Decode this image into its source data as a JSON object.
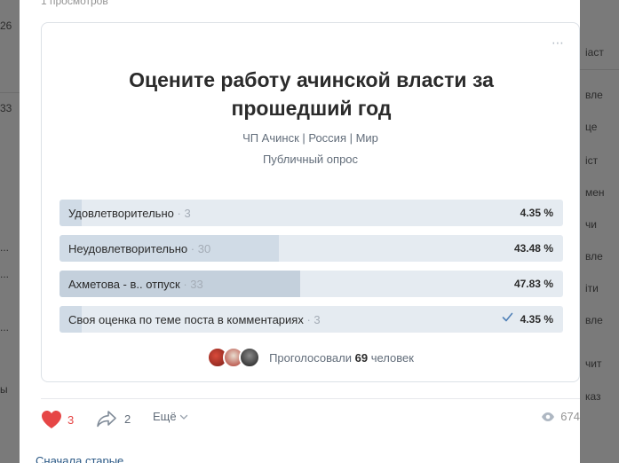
{
  "background": {
    "left_fragments": [
      "26",
      "33",
      "...",
      "...",
      "...",
      "ы"
    ],
    "right_fragments": [
      "іаст",
      "вле",
      "це",
      "іст",
      "мен",
      "чи",
      "вле",
      "іти",
      "вле",
      "чит",
      "каз"
    ]
  },
  "post": {
    "views_top": "1 просмотров",
    "poll": {
      "menu_icon": "⋯",
      "title": "Оцените работу ачинской власти за прошедший год",
      "source": "ЧП Ачинск | Россия | Мир",
      "type": "Публичный опрос",
      "options": [
        {
          "label": "Удовлетворительно",
          "count": "· 3",
          "percent": "4.35 %",
          "fraction": 0.0435,
          "voted": false
        },
        {
          "label": "Неудовлетворительно",
          "count": "· 30",
          "percent": "43.48 %",
          "fraction": 0.4348,
          "voted": false
        },
        {
          "label": "Ахметова - в.. отпуск",
          "count": "· 33",
          "percent": "47.83 %",
          "fraction": 0.4783,
          "voted": false,
          "leading": true
        },
        {
          "label": "Своя оценка по теме поста в комментариях",
          "count": "· 3",
          "percent": "4.35 %",
          "fraction": 0.0435,
          "voted": true
        }
      ],
      "voters_prefix": "Проголосовали",
      "voters_count": "69",
      "voters_suffix": "человек"
    },
    "actions": {
      "likes": "3",
      "shares": "2",
      "more_label": "Ещё",
      "views": "674"
    },
    "sort_label": "Сначала старые"
  },
  "colors": {
    "accent": "#2a5885",
    "like": "#e64646",
    "bar_bg": "#e5ebf1",
    "bar_fill": "#d0dbe6"
  }
}
